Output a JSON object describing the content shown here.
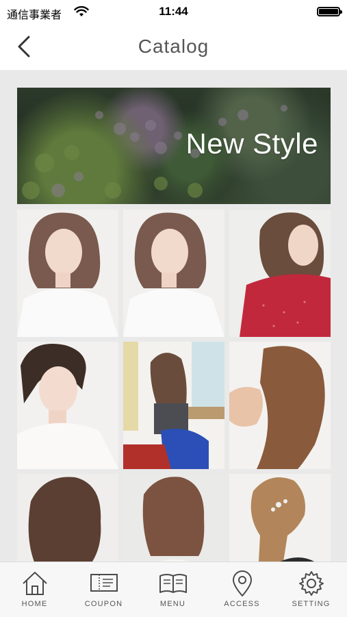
{
  "status_bar": {
    "carrier": "通信事業者",
    "time": "11:44"
  },
  "nav": {
    "title": "Catalog"
  },
  "banner": {
    "text": "New Style"
  },
  "gallery": {
    "items": [
      {
        "icon": "hairstyle-photo-1"
      },
      {
        "icon": "hairstyle-photo-2"
      },
      {
        "icon": "hairstyle-photo-3"
      },
      {
        "icon": "hairstyle-photo-4"
      },
      {
        "icon": "hairstyle-photo-5"
      },
      {
        "icon": "hairstyle-photo-6"
      },
      {
        "icon": "hairstyle-photo-7"
      },
      {
        "icon": "hairstyle-photo-8"
      },
      {
        "icon": "hairstyle-photo-9"
      }
    ]
  },
  "tabs": [
    {
      "label": "HOME",
      "icon": "home-icon"
    },
    {
      "label": "COUPON",
      "icon": "coupon-icon"
    },
    {
      "label": "MENU",
      "icon": "menu-book-icon"
    },
    {
      "label": "ACCESS",
      "icon": "location-pin-icon"
    },
    {
      "label": "SETTING",
      "icon": "gear-icon"
    }
  ],
  "colors": {
    "background": "#e9e9e9",
    "bar": "#ffffff",
    "tab_bar": "#f7f7f7",
    "text": "#555555"
  }
}
